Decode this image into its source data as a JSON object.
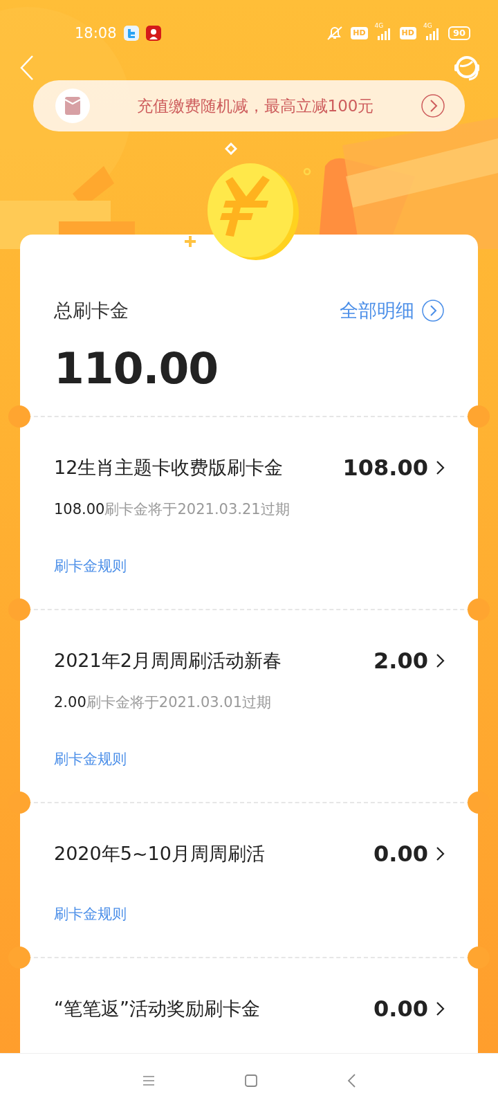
{
  "status_bar": {
    "time": "18:08",
    "hd_labels": [
      "HD",
      "HD"
    ],
    "network_labels": [
      "4G",
      "4G"
    ],
    "battery": "90"
  },
  "promo_banner": {
    "text": "充值缴费随机减，最高立减100元"
  },
  "summary": {
    "label": "总刷卡金",
    "amount": "110.00",
    "details_link": "全部明细"
  },
  "items": [
    {
      "title": "12生肖主题卡收费版刷卡金",
      "amount": "108.00",
      "expiry_amount": "108.00",
      "expiry_text": "刷卡金将于2021.03.21过期",
      "rules_link": "刷卡金规则"
    },
    {
      "title": "2021年2月周周刷活动新春",
      "amount": "2.00",
      "expiry_amount": "2.00",
      "expiry_text": "刷卡金将于2021.03.01过期",
      "rules_link": "刷卡金规则"
    },
    {
      "title": "2020年5~10月周周刷活",
      "amount": "0.00",
      "rules_link": "刷卡金规则"
    },
    {
      "title": "“笔笔返”活动奖励刷卡金",
      "amount": "0.00"
    }
  ]
}
